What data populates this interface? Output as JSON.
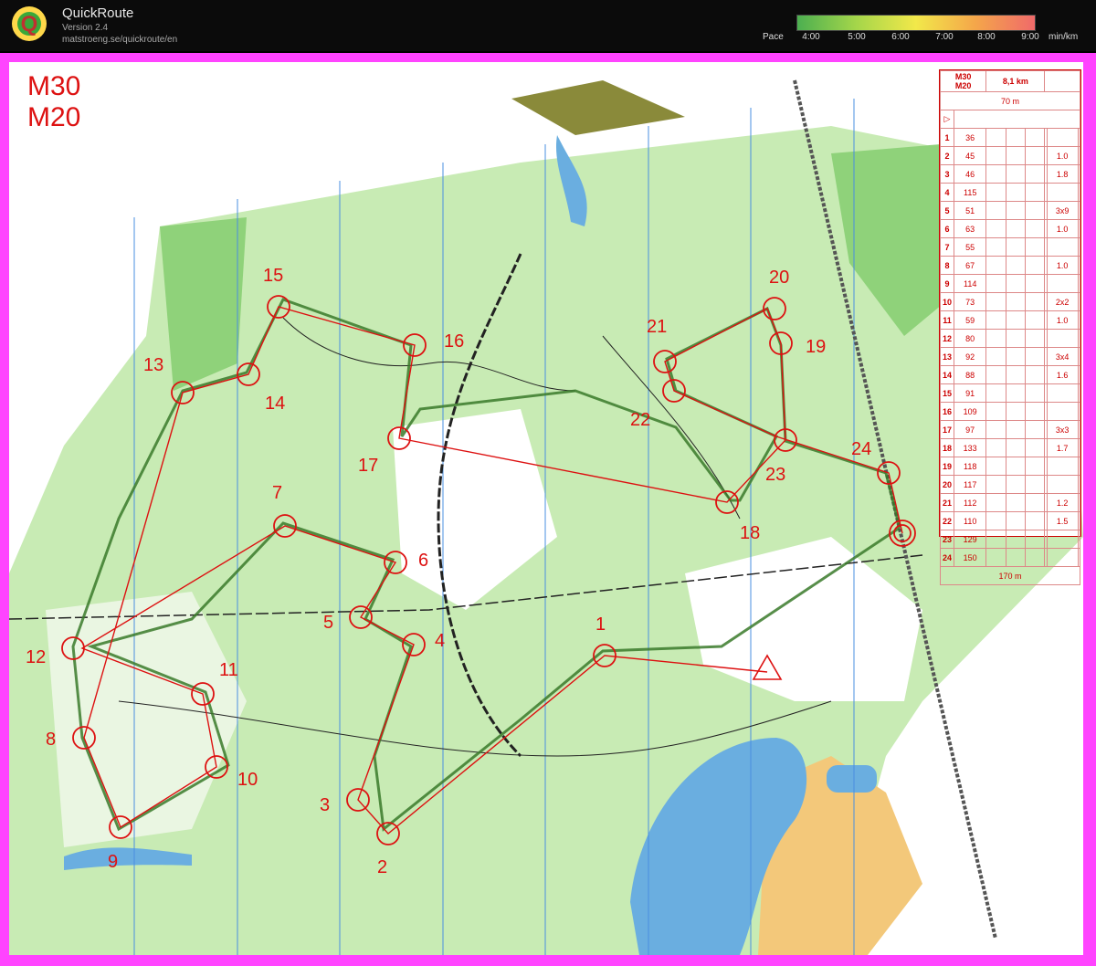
{
  "app": {
    "name": "QuickRoute",
    "version": "Version 2.4",
    "url": "matstroeng.se/quickroute/en",
    "logo_letter": "Q"
  },
  "pace_scale": {
    "label": "Pace",
    "ticks": [
      "4:00",
      "5:00",
      "6:00",
      "7:00",
      "8:00",
      "9:00"
    ],
    "unit": "min/km",
    "colors": [
      "#4caf50",
      "#a5d64a",
      "#f2e84a",
      "#f4a64a",
      "#f06a6a"
    ]
  },
  "course": {
    "classes": [
      "M30",
      "M20"
    ],
    "length": "8,1 km",
    "start_leg": "70 m",
    "finish_leg": "170 m",
    "controls": [
      {
        "n": "1",
        "code": "36"
      },
      {
        "n": "2",
        "code": "45",
        "dim": "1.0"
      },
      {
        "n": "3",
        "code": "46",
        "dim": "1.8"
      },
      {
        "n": "4",
        "code": "115"
      },
      {
        "n": "5",
        "code": "51",
        "dim": "3x9"
      },
      {
        "n": "6",
        "code": "63",
        "dim": "1.0"
      },
      {
        "n": "7",
        "code": "55"
      },
      {
        "n": "8",
        "code": "67",
        "dim": "1.0"
      },
      {
        "n": "9",
        "code": "114"
      },
      {
        "n": "10",
        "code": "73",
        "dim": "2x2"
      },
      {
        "n": "11",
        "code": "59",
        "dim": "1.0"
      },
      {
        "n": "12",
        "code": "80"
      },
      {
        "n": "13",
        "code": "92",
        "dim": "3x4"
      },
      {
        "n": "14",
        "code": "88",
        "dim": "1.6"
      },
      {
        "n": "15",
        "code": "91"
      },
      {
        "n": "16",
        "code": "109"
      },
      {
        "n": "17",
        "code": "97",
        "dim": "3x3"
      },
      {
        "n": "18",
        "code": "133",
        "dim": "1.7"
      },
      {
        "n": "19",
        "code": "118"
      },
      {
        "n": "20",
        "code": "117"
      },
      {
        "n": "21",
        "code": "112",
        "dim": "1.2"
      },
      {
        "n": "22",
        "code": "110",
        "dim": "1.5"
      },
      {
        "n": "23",
        "code": "129"
      },
      {
        "n": "24",
        "code": "150"
      }
    ]
  },
  "colors": {
    "course": "#d11111",
    "frame": "#ff44ff",
    "forest_light": "#c8ebb4",
    "forest_dark": "#8fd27a",
    "water": "#6aaee0",
    "route": "#3a7a2a"
  }
}
